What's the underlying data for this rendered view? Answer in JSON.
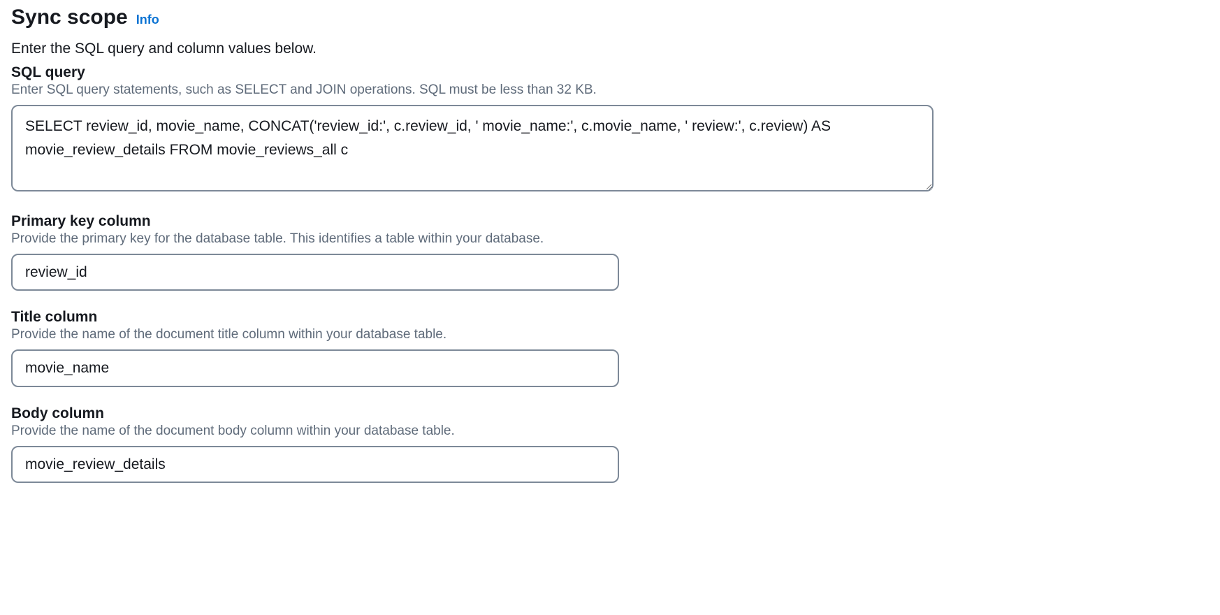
{
  "header": {
    "title": "Sync scope",
    "info_label": "Info"
  },
  "intro": "Enter the SQL query and column values below.",
  "fields": {
    "sql_query": {
      "label": "SQL query",
      "hint": "Enter SQL query statements, such as SELECT and JOIN operations. SQL must be less than 32 KB.",
      "value": "SELECT review_id, movie_name, CONCAT('review_id:', c.review_id, ' movie_name:', c.movie_name, ' review:', c.review) AS movie_review_details FROM movie_reviews_all c"
    },
    "primary_key": {
      "label": "Primary key column",
      "hint": "Provide the primary key for the database table. This identifies a table within your database.",
      "value": "review_id"
    },
    "title_column": {
      "label": "Title column",
      "hint": "Provide the name of the document title column within your database table.",
      "value": "movie_name"
    },
    "body_column": {
      "label": "Body column",
      "hint": "Provide the name of the document body column within your database table.",
      "value": "movie_review_details"
    }
  }
}
